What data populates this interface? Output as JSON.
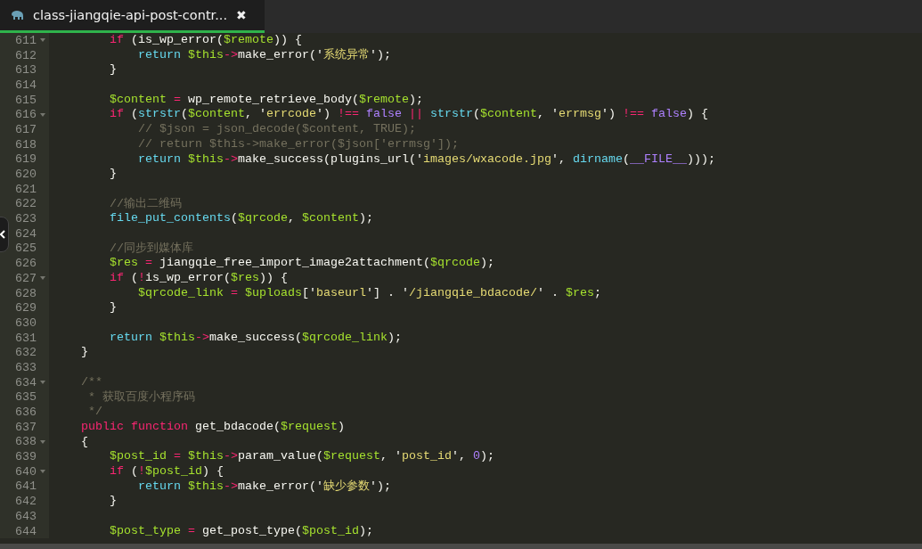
{
  "tabs": [
    {
      "title": "class-jiangqie-api-post-contr...",
      "close": "✖",
      "selected": true
    }
  ],
  "lines": [
    {
      "number": "611",
      "foldable": true,
      "tokens": [
        {
          "kind": "kw",
          "text": "        if"
        },
        {
          "kind": "plain",
          "text": " (is_wp_error("
        },
        {
          "kind": "var",
          "text": "$remote"
        },
        {
          "kind": "plain",
          "text": ")) {"
        }
      ]
    },
    {
      "number": "612",
      "foldable": false,
      "tokens": [
        {
          "kind": "fn",
          "text": "            return"
        },
        {
          "kind": "var",
          "text": " $this"
        },
        {
          "kind": "kw",
          "text": "->"
        },
        {
          "kind": "plain",
          "text": "make_error('"
        },
        {
          "kind": "str",
          "text": "系统异常"
        },
        {
          "kind": "plain",
          "text": "');"
        }
      ]
    },
    {
      "number": "613",
      "foldable": false,
      "tokens": [
        {
          "kind": "plain",
          "text": "        }"
        }
      ]
    },
    {
      "number": "614",
      "foldable": false
    },
    {
      "number": "615",
      "foldable": false,
      "tokens": [
        {
          "kind": "var",
          "text": "        $content"
        },
        {
          "kind": "kw",
          "text": " = "
        },
        {
          "kind": "plain",
          "text": "wp_remote_retrieve_body("
        },
        {
          "kind": "var",
          "text": "$remote"
        },
        {
          "kind": "plain",
          "text": ");"
        }
      ]
    },
    {
      "number": "616",
      "foldable": true,
      "tokens": [
        {
          "kind": "kw",
          "text": "        if"
        },
        {
          "kind": "plain",
          "text": " ("
        },
        {
          "kind": "fn",
          "text": "strstr"
        },
        {
          "kind": "plain",
          "text": "("
        },
        {
          "kind": "var",
          "text": "$content"
        },
        {
          "kind": "plain",
          "text": ", '"
        },
        {
          "kind": "str",
          "text": "errcode"
        },
        {
          "kind": "plain",
          "text": "') "
        },
        {
          "kind": "kw",
          "text": "!=="
        },
        {
          "kind": "const",
          "text": " false"
        },
        {
          "kind": "kw",
          "text": " ||"
        },
        {
          "kind": "fn",
          "text": " strstr"
        },
        {
          "kind": "plain",
          "text": "("
        },
        {
          "kind": "var",
          "text": "$content"
        },
        {
          "kind": "plain",
          "text": ", '"
        },
        {
          "kind": "str",
          "text": "errmsg"
        },
        {
          "kind": "plain",
          "text": "') "
        },
        {
          "kind": "kw",
          "text": "!=="
        },
        {
          "kind": "const",
          "text": " false"
        },
        {
          "kind": "plain",
          "text": ") {"
        }
      ]
    },
    {
      "number": "617",
      "foldable": false,
      "tokens": [
        {
          "kind": "comment",
          "text": "            // $json = json_decode($content, TRUE);"
        }
      ]
    },
    {
      "number": "618",
      "foldable": false,
      "tokens": [
        {
          "kind": "comment",
          "text": "            // return $this->make_error($json['errmsg']);"
        }
      ]
    },
    {
      "number": "619",
      "foldable": false,
      "tokens": [
        {
          "kind": "fn",
          "text": "            return"
        },
        {
          "kind": "var",
          "text": " $this"
        },
        {
          "kind": "kw",
          "text": "->"
        },
        {
          "kind": "plain",
          "text": "make_success(plugins_url('"
        },
        {
          "kind": "str",
          "text": "images/wxacode.jpg"
        },
        {
          "kind": "plain",
          "text": "', "
        },
        {
          "kind": "fn",
          "text": "dirname"
        },
        {
          "kind": "plain",
          "text": "("
        },
        {
          "kind": "const",
          "text": "__FILE__"
        },
        {
          "kind": "plain",
          "text": ")));"
        }
      ]
    },
    {
      "number": "620",
      "foldable": false,
      "tokens": [
        {
          "kind": "plain",
          "text": "        }"
        }
      ]
    },
    {
      "number": "621",
      "foldable": false
    },
    {
      "number": "622",
      "foldable": false,
      "tokens": [
        {
          "kind": "comment",
          "text": "        //输出二维码"
        }
      ]
    },
    {
      "number": "623",
      "foldable": false,
      "tokens": [
        {
          "kind": "fn",
          "text": "        file_put_contents"
        },
        {
          "kind": "plain",
          "text": "("
        },
        {
          "kind": "var",
          "text": "$qrcode"
        },
        {
          "kind": "plain",
          "text": ", "
        },
        {
          "kind": "var",
          "text": "$content"
        },
        {
          "kind": "plain",
          "text": ");"
        }
      ]
    },
    {
      "number": "624",
      "foldable": false
    },
    {
      "number": "625",
      "foldable": false,
      "tokens": [
        {
          "kind": "comment",
          "text": "        //同步到媒体库"
        }
      ]
    },
    {
      "number": "626",
      "foldable": false,
      "tokens": [
        {
          "kind": "var",
          "text": "        $res"
        },
        {
          "kind": "kw",
          "text": " = "
        },
        {
          "kind": "plain",
          "text": "jiangqie_free_import_image2attachment("
        },
        {
          "kind": "var",
          "text": "$qrcode"
        },
        {
          "kind": "plain",
          "text": ");"
        }
      ]
    },
    {
      "number": "627",
      "foldable": true,
      "tokens": [
        {
          "kind": "kw",
          "text": "        if"
        },
        {
          "kind": "plain",
          "text": " ("
        },
        {
          "kind": "kw",
          "text": "!"
        },
        {
          "kind": "plain",
          "text": "is_wp_error("
        },
        {
          "kind": "var",
          "text": "$res"
        },
        {
          "kind": "plain",
          "text": ")) {"
        }
      ]
    },
    {
      "number": "628",
      "foldable": false,
      "tokens": [
        {
          "kind": "var",
          "text": "            $qrcode_link"
        },
        {
          "kind": "kw",
          "text": " = "
        },
        {
          "kind": "var",
          "text": "$uploads"
        },
        {
          "kind": "plain",
          "text": "['"
        },
        {
          "kind": "str",
          "text": "baseurl"
        },
        {
          "kind": "plain",
          "text": "'] . '"
        },
        {
          "kind": "str",
          "text": "/jiangqie_bdacode/"
        },
        {
          "kind": "plain",
          "text": "' . "
        },
        {
          "kind": "var",
          "text": "$res"
        },
        {
          "kind": "plain",
          "text": ";"
        }
      ]
    },
    {
      "number": "629",
      "foldable": false,
      "tokens": [
        {
          "kind": "plain",
          "text": "        }"
        }
      ]
    },
    {
      "number": "630",
      "foldable": false
    },
    {
      "number": "631",
      "foldable": false,
      "tokens": [
        {
          "kind": "fn",
          "text": "        return"
        },
        {
          "kind": "var",
          "text": " $this"
        },
        {
          "kind": "kw",
          "text": "->"
        },
        {
          "kind": "plain",
          "text": "make_success("
        },
        {
          "kind": "var",
          "text": "$qrcode_link"
        },
        {
          "kind": "plain",
          "text": ");"
        }
      ]
    },
    {
      "number": "632",
      "foldable": false,
      "tokens": [
        {
          "kind": "plain",
          "text": "    }"
        }
      ]
    },
    {
      "number": "633",
      "foldable": false
    },
    {
      "number": "634",
      "foldable": true,
      "tokens": [
        {
          "kind": "comment",
          "text": "    /**"
        }
      ]
    },
    {
      "number": "635",
      "foldable": false,
      "tokens": [
        {
          "kind": "comment",
          "text": "     * 获取百度小程序码"
        }
      ]
    },
    {
      "number": "636",
      "foldable": false,
      "tokens": [
        {
          "kind": "comment",
          "text": "     */"
        }
      ]
    },
    {
      "number": "637",
      "foldable": false,
      "tokens": [
        {
          "kind": "kw",
          "text": "    public"
        },
        {
          "kind": "kw",
          "text": " function"
        },
        {
          "kind": "plain",
          "text": " get_bdacode("
        },
        {
          "kind": "var",
          "text": "$request"
        },
        {
          "kind": "plain",
          "text": ")"
        }
      ]
    },
    {
      "number": "638",
      "foldable": true,
      "tokens": [
        {
          "kind": "plain",
          "text": "    {"
        }
      ]
    },
    {
      "number": "639",
      "foldable": false,
      "tokens": [
        {
          "kind": "var",
          "text": "        $post_id"
        },
        {
          "kind": "kw",
          "text": " = "
        },
        {
          "kind": "var",
          "text": "$this"
        },
        {
          "kind": "kw",
          "text": "->"
        },
        {
          "kind": "plain",
          "text": "param_value("
        },
        {
          "kind": "var",
          "text": "$request"
        },
        {
          "kind": "plain",
          "text": ", '"
        },
        {
          "kind": "str",
          "text": "post_id"
        },
        {
          "kind": "plain",
          "text": "', "
        },
        {
          "kind": "const",
          "text": "0"
        },
        {
          "kind": "plain",
          "text": ");"
        }
      ]
    },
    {
      "number": "640",
      "foldable": true,
      "tokens": [
        {
          "kind": "kw",
          "text": "        if"
        },
        {
          "kind": "plain",
          "text": " ("
        },
        {
          "kind": "kw",
          "text": "!"
        },
        {
          "kind": "var",
          "text": "$post_id"
        },
        {
          "kind": "plain",
          "text": ") {"
        }
      ]
    },
    {
      "number": "641",
      "foldable": false,
      "tokens": [
        {
          "kind": "fn",
          "text": "            return"
        },
        {
          "kind": "var",
          "text": " $this"
        },
        {
          "kind": "kw",
          "text": "->"
        },
        {
          "kind": "plain",
          "text": "make_error('"
        },
        {
          "kind": "str",
          "text": "缺少参数"
        },
        {
          "kind": "plain",
          "text": "');"
        }
      ]
    },
    {
      "number": "642",
      "foldable": false,
      "tokens": [
        {
          "kind": "plain",
          "text": "        }"
        }
      ]
    },
    {
      "number": "643",
      "foldable": false
    },
    {
      "number": "644",
      "foldable": false,
      "tokens": [
        {
          "kind": "var",
          "text": "        $post_type"
        },
        {
          "kind": "kw",
          "text": " = "
        },
        {
          "kind": "plain",
          "text": "get_post_type("
        },
        {
          "kind": "var",
          "text": "$post_id"
        },
        {
          "kind": "plain",
          "text": ");"
        }
      ]
    }
  ]
}
